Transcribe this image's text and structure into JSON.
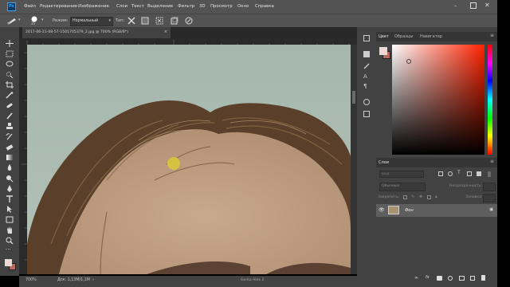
{
  "app": {
    "logo": "Ps"
  },
  "menu": [
    "Файл",
    "Редактирование",
    "Изображение",
    "Слои",
    "Текст",
    "Выделение",
    "Фильтр",
    "3D",
    "Просмотр",
    "Окно",
    "Справка"
  ],
  "options": {
    "brush_size": "35",
    "mode_label": "Режим:",
    "mode_value": "Нормальный",
    "type_label": "Тип:"
  },
  "document": {
    "tab_title": "2017-06-21-08-57-1501705379_2.jpg @ 700% (RGB/8*)",
    "zoom": "700%",
    "doc_info": "Док: 1,13М/1,1М",
    "bottom_label": "Gorka Alex 2"
  },
  "color_panel": {
    "tabs": [
      "Цвет",
      "Образцы",
      "Навигатор"
    ],
    "active_tab": 0,
    "hue_color": "#ff2200",
    "foreground": "#f2d6cf",
    "background": "#b56a60"
  },
  "layers_panel": {
    "title": "Слои",
    "search_placeholder": "Вид",
    "blend_mode": "Обычные",
    "opacity_label": "Непрозрачность:",
    "lock_label": "Закрепить:",
    "fill_label": "Заливка:",
    "layers": [
      {
        "name": "Фон",
        "visible": true,
        "locked": true
      }
    ]
  },
  "colors": {
    "accent": "#3a8ee6",
    "chrome": "#535353",
    "panel": "#424242"
  }
}
